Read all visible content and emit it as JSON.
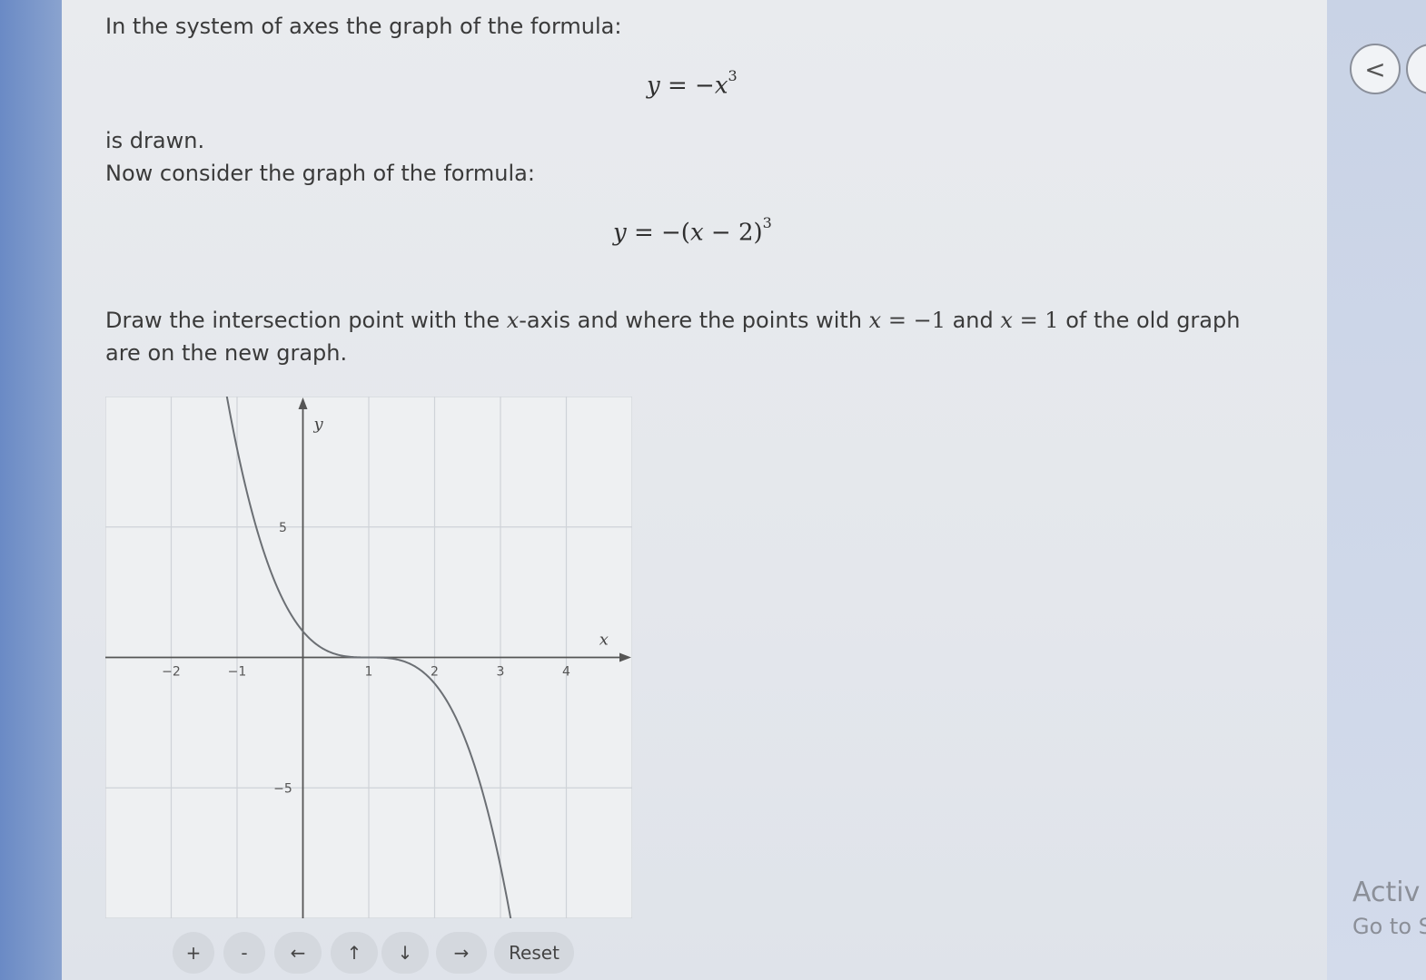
{
  "question": {
    "intro": "In the system of axes the graph of the formula:",
    "formula_old": {
      "lhs": "y",
      "eq": " = −",
      "var": "x",
      "exp": "3"
    },
    "drawn": "is drawn.",
    "consider": "Now consider the graph of the formula:",
    "formula_new": {
      "lhs": "y",
      "eq": " = −(",
      "var": "x",
      "rest": " − 2)",
      "exp": "3"
    },
    "instruction": {
      "part1": "Draw the intersection point with the ",
      "xvar1": "x",
      "part2": "-axis and where the points with ",
      "xvar2": "x",
      "eq1": " = −1",
      "part3": " and ",
      "xvar3": "x",
      "eq2": " = 1",
      "part4": " of the old graph",
      "line2": "are on the new graph."
    }
  },
  "chart_data": {
    "type": "line",
    "xlabel": "x",
    "ylabel": "y",
    "xlim": [
      -3,
      5
    ],
    "ylim": [
      -10,
      10
    ],
    "grid": true,
    "x_ticks": [
      -2,
      -1,
      1,
      2,
      3,
      4
    ],
    "x_tick_labels": [
      "−2",
      "−1",
      "1",
      "2",
      "3",
      "4"
    ],
    "y_ticks": [
      5,
      -5
    ],
    "y_tick_labels": [
      "5",
      "−5"
    ],
    "series": [
      {
        "formula": "y = -(x-1)^3",
        "x_range": [
          -1.2,
          3.2
        ]
      }
    ]
  },
  "controls": {
    "zoom_in": "+",
    "zoom_out": "-",
    "left": "←",
    "up": "↑",
    "down": "↓",
    "right": "→",
    "reset": "Reset"
  },
  "nav": {
    "back_symbol": "<"
  },
  "watermark": {
    "line1": "Activ",
    "line2": "Go to S"
  }
}
